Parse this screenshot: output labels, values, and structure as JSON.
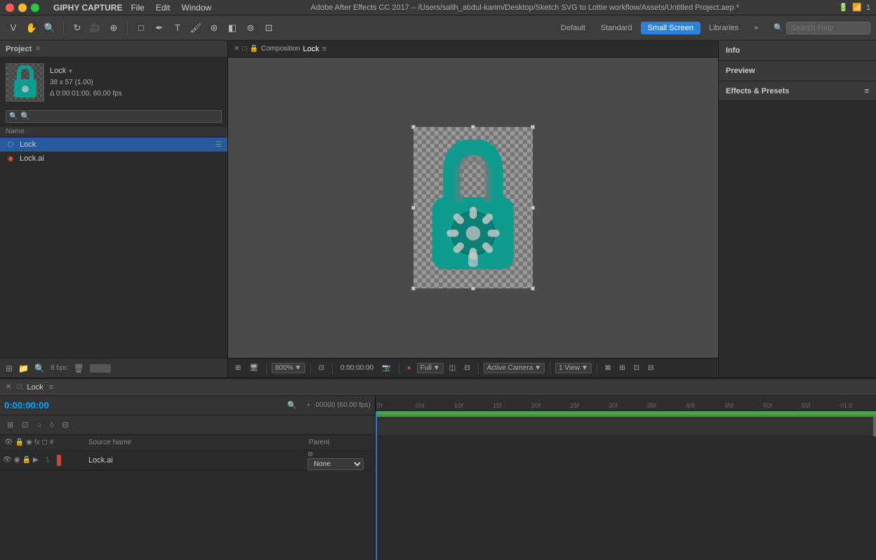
{
  "macbar": {
    "app": "GIPHY CAPTURE",
    "menus": [
      "File",
      "Edit",
      "Window"
    ],
    "title": "Adobe After Effects CC 2017 – /Users/salih_abdul-karim/Desktop/Sketch SVG to Lottie workflow/Assets/Untitled Project.aep *",
    "right": "1"
  },
  "toolbar": {
    "workspaces": [
      "Default",
      "Standard",
      "Small Screen",
      "Libraries"
    ],
    "active_workspace": "Small Screen",
    "search_placeholder": "Search Help",
    "more": "»"
  },
  "project": {
    "panel_title": "Project",
    "comp_name": "Lock",
    "comp_arrow": "▾",
    "comp_dimensions": "38 x 57 (1.00)",
    "comp_time": "Δ 0:00:01:00, 60.00 fps",
    "search_placeholder": "🔍",
    "column_name": "Name",
    "files": [
      {
        "type": "comp",
        "name": "Lock",
        "icon": "⬡"
      },
      {
        "type": "ai",
        "name": "Lock.ai",
        "icon": "◉"
      }
    ],
    "bpc": "8 bpc"
  },
  "composition": {
    "tab_label": "Composition Lock",
    "menu_icon": "≡",
    "zoom": "800%",
    "timecode": "0:00:00:00",
    "quality": "Full",
    "camera": "Active Camera",
    "views": "1 View"
  },
  "right_panels": {
    "info_label": "Info",
    "preview_label": "Preview",
    "effects_label": "Effects & Presets",
    "menu_icon": "≡"
  },
  "timeline": {
    "tab_label": "Lock",
    "menu_icon": "≡",
    "time": "0:00:00:00",
    "fps": "00000 (60.00 fps)",
    "columns": {
      "name": "Source Name",
      "parent": "Parent"
    },
    "layers": [
      {
        "num": "1",
        "name": "Lock.ai",
        "parent": "None",
        "color": "#cc4444"
      }
    ],
    "ruler_ticks": [
      "0f",
      "05f",
      "10f",
      "15f",
      "20f",
      "25f",
      "30f",
      "35f",
      "40f",
      "45f",
      "50f",
      "55f",
      "01:0"
    ]
  }
}
